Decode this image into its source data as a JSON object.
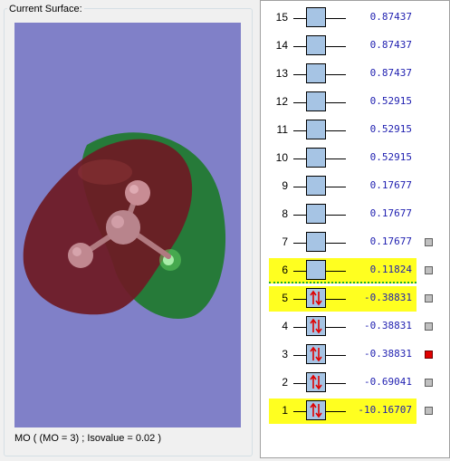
{
  "surface_panel": {
    "title": "Current Surface:",
    "status": "MO ( (MO = 3) ; Isovalue = 0.02 )"
  },
  "colors": {
    "viewport_bg": "#8080c8",
    "lobe_positive": "#1e7a2c",
    "lobe_negative": "#6e1a24",
    "atom": "#c08a90",
    "highlight": "#ffff20",
    "energy_text": "#1f1fb0",
    "selected_checkbox": "#e00000"
  },
  "orbitals": [
    {
      "number": "15",
      "energy": "0.87437",
      "occupied": false,
      "highlight": false,
      "checkbox": "none"
    },
    {
      "number": "14",
      "energy": "0.87437",
      "occupied": false,
      "highlight": false,
      "checkbox": "none"
    },
    {
      "number": "13",
      "energy": "0.87437",
      "occupied": false,
      "highlight": false,
      "checkbox": "none"
    },
    {
      "number": "12",
      "energy": "0.52915",
      "occupied": false,
      "highlight": false,
      "checkbox": "none"
    },
    {
      "number": "11",
      "energy": "0.52915",
      "occupied": false,
      "highlight": false,
      "checkbox": "none"
    },
    {
      "number": "10",
      "energy": "0.52915",
      "occupied": false,
      "highlight": false,
      "checkbox": "none"
    },
    {
      "number": "9",
      "energy": "0.17677",
      "occupied": false,
      "highlight": false,
      "checkbox": "none"
    },
    {
      "number": "8",
      "energy": "0.17677",
      "occupied": false,
      "highlight": false,
      "checkbox": "none"
    },
    {
      "number": "7",
      "energy": "0.17677",
      "occupied": false,
      "highlight": false,
      "checkbox": "gray"
    },
    {
      "number": "6",
      "energy": "0.11824",
      "occupied": false,
      "highlight": true,
      "checkbox": "gray"
    },
    {
      "number": "5",
      "energy": "-0.38831",
      "occupied": true,
      "highlight": true,
      "checkbox": "gray"
    },
    {
      "number": "4",
      "energy": "-0.38831",
      "occupied": true,
      "highlight": false,
      "checkbox": "gray"
    },
    {
      "number": "3",
      "energy": "-0.38831",
      "occupied": true,
      "highlight": false,
      "checkbox": "red"
    },
    {
      "number": "2",
      "energy": "-0.69041",
      "occupied": true,
      "highlight": false,
      "checkbox": "gray"
    },
    {
      "number": "1",
      "energy": "-10.16707",
      "occupied": true,
      "highlight": true,
      "checkbox": "gray"
    }
  ]
}
